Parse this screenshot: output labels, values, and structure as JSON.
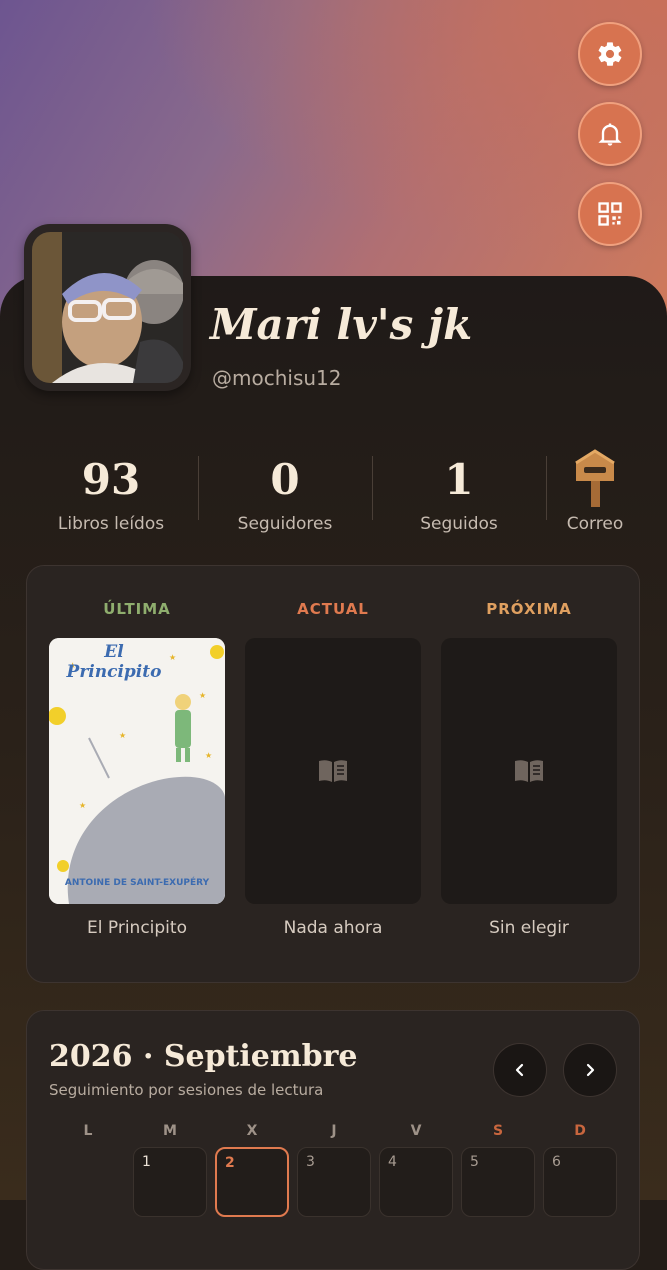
{
  "header": {
    "buttons": [
      {
        "name": "settings",
        "icon": "gear-icon"
      },
      {
        "name": "notifications",
        "icon": "bell-icon"
      },
      {
        "name": "qr",
        "icon": "qr-code-icon"
      }
    ]
  },
  "profile": {
    "display_name": "Mari lv's jk",
    "handle": "@mochisu12"
  },
  "stats": [
    {
      "value": "93",
      "label": "Libros leídos"
    },
    {
      "value": "0",
      "label": "Seguidores"
    },
    {
      "value": "1",
      "label": "Seguidos"
    }
  ],
  "mail": {
    "label": "Correo",
    "icon": "mailbox-icon"
  },
  "reading": {
    "columns": [
      {
        "label": "ÚLTIMA",
        "color": "#8fae6e",
        "caption": "El Principito",
        "cover_title_line1": "El",
        "cover_title_line2": "Principito",
        "cover_author": "ANTOINE DE SAINT-EXUPÉRY"
      },
      {
        "label": "ACTUAL",
        "color": "#e07a4f",
        "caption": "Nada ahora",
        "icon": "book-icon"
      },
      {
        "label": "PRÓXIMA",
        "color": "#e0a060",
        "caption": "Sin elegir",
        "icon": "book-icon"
      }
    ]
  },
  "calendar": {
    "title": "2026 · Septiembre",
    "subtitle": "Seguimiento por sesiones de lectura",
    "weekdays": [
      "L",
      "M",
      "X",
      "J",
      "V",
      "S",
      "D"
    ],
    "days": [
      "1",
      "2",
      "3",
      "4",
      "5",
      "6"
    ],
    "today": "2",
    "accent": "#e07a4f"
  }
}
